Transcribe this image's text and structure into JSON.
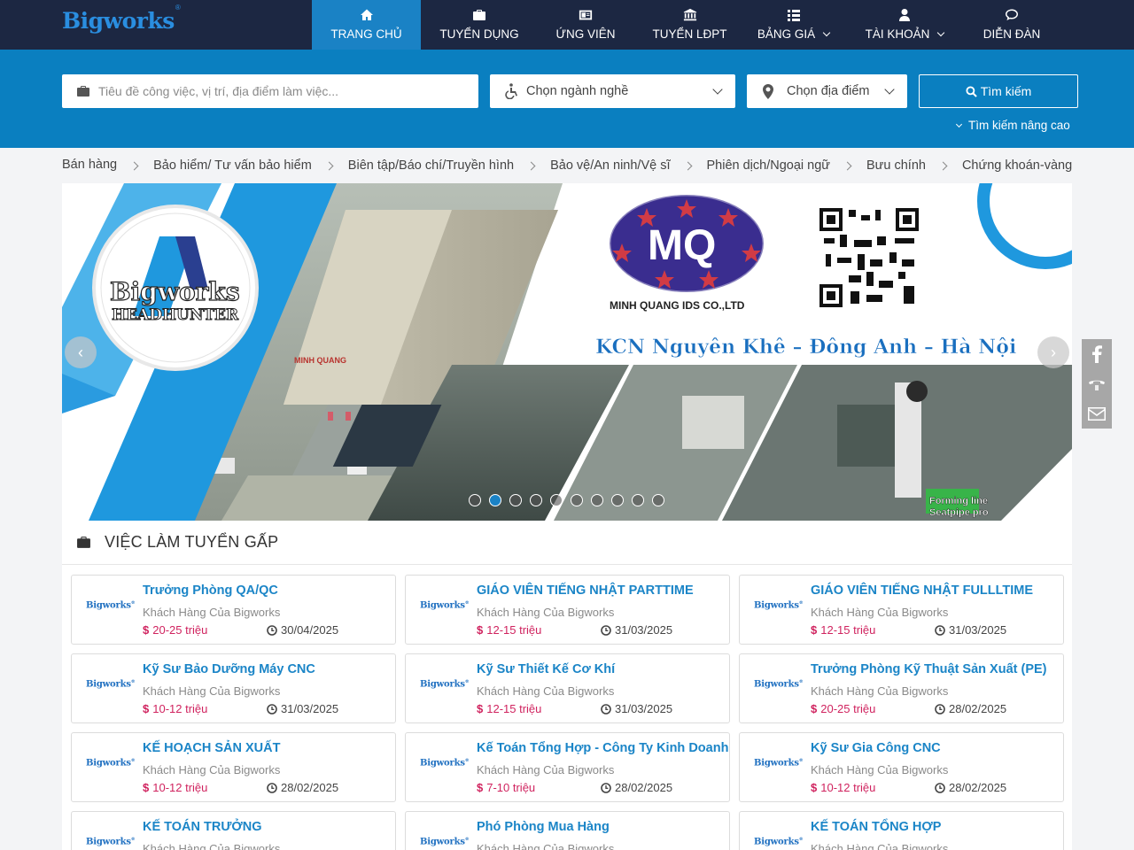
{
  "logo": {
    "text": "Bigworks",
    "mark": "®"
  },
  "nav": [
    {
      "label": "TRANG CHỦ",
      "icon": "home-icon",
      "active": true
    },
    {
      "label": "TUYỂN DỤNG",
      "icon": "briefcase-icon"
    },
    {
      "label": "ỨNG VIÊN",
      "icon": "id-card-icon"
    },
    {
      "label": "TUYỂN LĐPT",
      "icon": "bank-icon"
    },
    {
      "label": "BẢNG GIÁ",
      "icon": "list-icon",
      "dropdown": true
    },
    {
      "label": "TÀI KHOẢN",
      "icon": "user-icon",
      "dropdown": true
    },
    {
      "label": "DIỄN ĐÀN",
      "icon": "chat-icon"
    }
  ],
  "search": {
    "placeholder": "Tiêu đề công việc, vị trí, địa điểm làm việc...",
    "industry": "Chọn ngành nghề",
    "location": "Chọn địa điểm",
    "button": "Tìm kiếm",
    "advanced": "Tìm kiếm nâng cao"
  },
  "categories": [
    "Bán hàng",
    "Bảo hiểm/ Tư vấn bảo hiểm",
    "Biên tập/Báo chí/Truyền hình",
    "Bảo vệ/An ninh/Vệ sĩ",
    "Phiên dịch/Ngoại ngữ",
    "Bưu chính",
    "Chứng khoán-vàng"
  ],
  "banner": {
    "logo_text": "Bigworks",
    "logo_sub": "HEADHUNTER",
    "company_mark": "MQ",
    "company_name": "MINH QUANG IDS CO.,LTD",
    "location_text": "KCN Nguyên Khê – Đông Anh – Hà Nội",
    "factory_sign": "MINH QUANG",
    "caption_1": "Forming line",
    "caption_2": "Seatpipe pro",
    "slide_count": 10,
    "active_slide": 2
  },
  "urgent": {
    "title": "VIỆC LÀM TUYỂN GẤP",
    "jobs": [
      {
        "title": "Trưởng Phòng QA/QC",
        "company": "Khách Hàng Của Bigworks",
        "salary": "20-25 triệu",
        "date": "30/04/2025"
      },
      {
        "title": "GIÁO VIÊN TIẾNG NHẬT PARTTIME",
        "company": "Khách Hàng Của Bigworks",
        "salary": "12-15 triệu",
        "date": "31/03/2025"
      },
      {
        "title": "GIÁO VIÊN TIẾNG NHẬT FULLLTIME",
        "company": "Khách Hàng Của Bigworks",
        "salary": "12-15 triệu",
        "date": "31/03/2025"
      },
      {
        "title": "Kỹ Sư Bảo Dưỡng Máy CNC",
        "company": "Khách Hàng Của Bigworks",
        "salary": "10-12 triệu",
        "date": "31/03/2025"
      },
      {
        "title": "Kỹ Sư Thiết Kế Cơ Khí",
        "company": "Khách Hàng Của Bigworks",
        "salary": "12-15 triệu",
        "date": "31/03/2025"
      },
      {
        "title": "Trưởng Phòng Kỹ Thuật Sản Xuất (PE)",
        "company": "Khách Hàng Của Bigworks",
        "salary": "20-25 triệu",
        "date": "28/02/2025"
      },
      {
        "title": "KẾ HOẠCH SẢN XUẤT",
        "company": "Khách Hàng Của Bigworks",
        "salary": "10-12 triệu",
        "date": "28/02/2025"
      },
      {
        "title": "Kế Toán Tổng Hợp - Công Ty Kinh Doanh",
        "company": "Khách Hàng Của Bigworks",
        "salary": "7-10 triệu",
        "date": "28/02/2025"
      },
      {
        "title": "Kỹ Sư Gia Công CNC",
        "company": "Khách Hàng Của Bigworks",
        "salary": "10-12 triệu",
        "date": "28/02/2025"
      },
      {
        "title": "KẾ TOÁN TRƯỞNG",
        "company": "Khách Hàng Của Bigworks",
        "salary": "",
        "date": ""
      },
      {
        "title": "Phó Phòng Mua Hàng",
        "company": "Khách Hàng Của Bigworks",
        "salary": "",
        "date": ""
      },
      {
        "title": "KẾ TOÁN TỔNG HỢP",
        "company": "Khách Hàng Của Bigworks",
        "salary": "",
        "date": ""
      }
    ]
  },
  "colors": {
    "navbar": "#1c2742",
    "accent": "#1a82c5",
    "search_band": "#0a7fc0",
    "salary": "#d0235f"
  }
}
